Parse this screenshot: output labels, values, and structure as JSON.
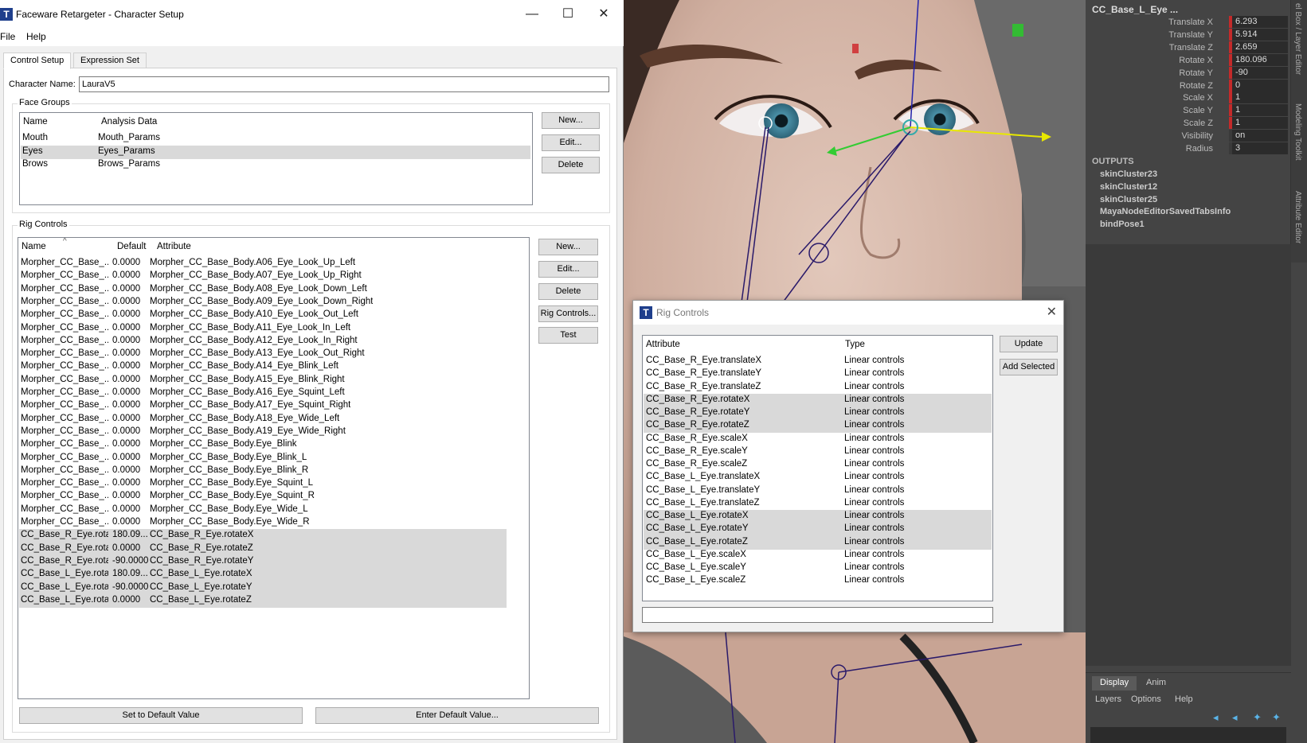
{
  "window": {
    "icon": "T",
    "title": "Faceware Retargeter - Character Setup",
    "controls": {
      "minimize": "—",
      "maximize": "☐",
      "close": "✕"
    }
  },
  "menu": [
    "File",
    "Help"
  ],
  "tabs": [
    "Control Setup",
    "Expression Set"
  ],
  "character": {
    "label": "Character Name:",
    "value": "LauraV5"
  },
  "face_groups": {
    "title": "Face Groups",
    "headers": [
      "Name",
      "Analysis Data"
    ],
    "rows": [
      {
        "name": "Mouth",
        "data": "Mouth_Params",
        "selected": false
      },
      {
        "name": "Eyes",
        "data": "Eyes_Params",
        "selected": true
      },
      {
        "name": "Brows",
        "data": "Brows_Params",
        "selected": false
      }
    ],
    "buttons": [
      "New...",
      "Edit...",
      "Delete"
    ]
  },
  "rig_controls": {
    "title": "Rig Controls",
    "headers": [
      "Name",
      "Default",
      "Attribute"
    ],
    "sort_indicator": "^",
    "rows": [
      {
        "name": "Morpher_CC_Base_...",
        "default": "0.0000",
        "attr": "Morpher_CC_Base_Body.A06_Eye_Look_Up_Left",
        "selected": false
      },
      {
        "name": "Morpher_CC_Base_...",
        "default": "0.0000",
        "attr": "Morpher_CC_Base_Body.A07_Eye_Look_Up_Right",
        "selected": false
      },
      {
        "name": "Morpher_CC_Base_...",
        "default": "0.0000",
        "attr": "Morpher_CC_Base_Body.A08_Eye_Look_Down_Left",
        "selected": false
      },
      {
        "name": "Morpher_CC_Base_...",
        "default": "0.0000",
        "attr": "Morpher_CC_Base_Body.A09_Eye_Look_Down_Right",
        "selected": false
      },
      {
        "name": "Morpher_CC_Base_...",
        "default": "0.0000",
        "attr": "Morpher_CC_Base_Body.A10_Eye_Look_Out_Left",
        "selected": false
      },
      {
        "name": "Morpher_CC_Base_...",
        "default": "0.0000",
        "attr": "Morpher_CC_Base_Body.A11_Eye_Look_In_Left",
        "selected": false
      },
      {
        "name": "Morpher_CC_Base_...",
        "default": "0.0000",
        "attr": "Morpher_CC_Base_Body.A12_Eye_Look_In_Right",
        "selected": false
      },
      {
        "name": "Morpher_CC_Base_...",
        "default": "0.0000",
        "attr": "Morpher_CC_Base_Body.A13_Eye_Look_Out_Right",
        "selected": false
      },
      {
        "name": "Morpher_CC_Base_...",
        "default": "0.0000",
        "attr": "Morpher_CC_Base_Body.A14_Eye_Blink_Left",
        "selected": false
      },
      {
        "name": "Morpher_CC_Base_...",
        "default": "0.0000",
        "attr": "Morpher_CC_Base_Body.A15_Eye_Blink_Right",
        "selected": false
      },
      {
        "name": "Morpher_CC_Base_...",
        "default": "0.0000",
        "attr": "Morpher_CC_Base_Body.A16_Eye_Squint_Left",
        "selected": false
      },
      {
        "name": "Morpher_CC_Base_...",
        "default": "0.0000",
        "attr": "Morpher_CC_Base_Body.A17_Eye_Squint_Right",
        "selected": false
      },
      {
        "name": "Morpher_CC_Base_...",
        "default": "0.0000",
        "attr": "Morpher_CC_Base_Body.A18_Eye_Wide_Left",
        "selected": false
      },
      {
        "name": "Morpher_CC_Base_...",
        "default": "0.0000",
        "attr": "Morpher_CC_Base_Body.A19_Eye_Wide_Right",
        "selected": false
      },
      {
        "name": "Morpher_CC_Base_...",
        "default": "0.0000",
        "attr": "Morpher_CC_Base_Body.Eye_Blink",
        "selected": false
      },
      {
        "name": "Morpher_CC_Base_...",
        "default": "0.0000",
        "attr": "Morpher_CC_Base_Body.Eye_Blink_L",
        "selected": false
      },
      {
        "name": "Morpher_CC_Base_...",
        "default": "0.0000",
        "attr": "Morpher_CC_Base_Body.Eye_Blink_R",
        "selected": false
      },
      {
        "name": "Morpher_CC_Base_...",
        "default": "0.0000",
        "attr": "Morpher_CC_Base_Body.Eye_Squint_L",
        "selected": false
      },
      {
        "name": "Morpher_CC_Base_...",
        "default": "0.0000",
        "attr": "Morpher_CC_Base_Body.Eye_Squint_R",
        "selected": false
      },
      {
        "name": "Morpher_CC_Base_...",
        "default": "0.0000",
        "attr": "Morpher_CC_Base_Body.Eye_Wide_L",
        "selected": false
      },
      {
        "name": "Morpher_CC_Base_...",
        "default": "0.0000",
        "attr": "Morpher_CC_Base_Body.Eye_Wide_R",
        "selected": false
      },
      {
        "name": "CC_Base_R_Eye.rota...",
        "default": "180.09...",
        "attr": "CC_Base_R_Eye.rotateX",
        "selected": true
      },
      {
        "name": "CC_Base_R_Eye.rota...",
        "default": "0.0000",
        "attr": "CC_Base_R_Eye.rotateZ",
        "selected": true
      },
      {
        "name": "CC_Base_R_Eye.rota...",
        "default": "-90.0000",
        "attr": "CC_Base_R_Eye.rotateY",
        "selected": true
      },
      {
        "name": "CC_Base_L_Eye.rota...",
        "default": "180.09...",
        "attr": "CC_Base_L_Eye.rotateX",
        "selected": true
      },
      {
        "name": "CC_Base_L_Eye.rota...",
        "default": "-90.0000",
        "attr": "CC_Base_L_Eye.rotateY",
        "selected": true
      },
      {
        "name": "CC_Base_L_Eye.rota...",
        "default": "0.0000",
        "attr": "CC_Base_L_Eye.rotateZ",
        "selected": true
      }
    ],
    "buttons": [
      "New...",
      "Edit...",
      "Delete",
      "Rig Controls...",
      "Test"
    ],
    "bottom_buttons": [
      "Set to Default Value",
      "Enter Default Value..."
    ]
  },
  "rig_dialog": {
    "icon": "T",
    "title": "Rig Controls",
    "close": "✕",
    "headers": [
      "Attribute",
      "Type"
    ],
    "rows": [
      {
        "attr": "CC_Base_R_Eye.translateX",
        "type": "Linear controls",
        "selected": false
      },
      {
        "attr": "CC_Base_R_Eye.translateY",
        "type": "Linear controls",
        "selected": false
      },
      {
        "attr": "CC_Base_R_Eye.translateZ",
        "type": "Linear controls",
        "selected": false
      },
      {
        "attr": "CC_Base_R_Eye.rotateX",
        "type": "Linear controls",
        "selected": true
      },
      {
        "attr": "CC_Base_R_Eye.rotateY",
        "type": "Linear controls",
        "selected": true
      },
      {
        "attr": "CC_Base_R_Eye.rotateZ",
        "type": "Linear controls",
        "selected": true
      },
      {
        "attr": "CC_Base_R_Eye.scaleX",
        "type": "Linear controls",
        "selected": false
      },
      {
        "attr": "CC_Base_R_Eye.scaleY",
        "type": "Linear controls",
        "selected": false
      },
      {
        "attr": "CC_Base_R_Eye.scaleZ",
        "type": "Linear controls",
        "selected": false
      },
      {
        "attr": "CC_Base_L_Eye.translateX",
        "type": "Linear controls",
        "selected": false
      },
      {
        "attr": "CC_Base_L_Eye.translateY",
        "type": "Linear controls",
        "selected": false
      },
      {
        "attr": "CC_Base_L_Eye.translateZ",
        "type": "Linear controls",
        "selected": false
      },
      {
        "attr": "CC_Base_L_Eye.rotateX",
        "type": "Linear controls",
        "selected": true
      },
      {
        "attr": "CC_Base_L_Eye.rotateY",
        "type": "Linear controls",
        "selected": true
      },
      {
        "attr": "CC_Base_L_Eye.rotateZ",
        "type": "Linear controls",
        "selected": true
      },
      {
        "attr": "CC_Base_L_Eye.scaleX",
        "type": "Linear controls",
        "selected": false
      },
      {
        "attr": "CC_Base_L_Eye.scaleY",
        "type": "Linear controls",
        "selected": false
      },
      {
        "attr": "CC_Base_L_Eye.scaleZ",
        "type": "Linear controls",
        "selected": false
      }
    ],
    "buttons": [
      "Update",
      "Add Selected"
    ]
  },
  "maya": {
    "node_title": "CC_Base_L_Eye ...",
    "attributes": [
      {
        "label": "Translate X",
        "value": "6.293",
        "keyed": true
      },
      {
        "label": "Translate Y",
        "value": "5.914",
        "keyed": true
      },
      {
        "label": "Translate Z",
        "value": "2.659",
        "keyed": true
      },
      {
        "label": "Rotate X",
        "value": "180.096",
        "keyed": true
      },
      {
        "label": "Rotate Y",
        "value": "-90",
        "keyed": true
      },
      {
        "label": "Rotate Z",
        "value": "0",
        "keyed": true
      },
      {
        "label": "Scale X",
        "value": "1",
        "keyed": true
      },
      {
        "label": "Scale Y",
        "value": "1",
        "keyed": true
      },
      {
        "label": "Scale Z",
        "value": "1",
        "keyed": true
      },
      {
        "label": "Visibility",
        "value": "on",
        "keyed": false
      },
      {
        "label": "Radius",
        "value": "3",
        "keyed": false
      }
    ],
    "outputs_title": "OUTPUTS",
    "outputs": [
      "skinCluster23",
      "skinCluster12",
      "skinCluster25",
      "MayaNodeEditorSavedTabsInfo",
      "bindPose1"
    ],
    "side_tabs": [
      "el Box / Layer Editor",
      "Modeling Toolkit",
      "Attribute Editor"
    ],
    "layer_tabs": [
      "Display",
      "Anim"
    ],
    "layer_menu": [
      "Layers",
      "Options",
      "Help"
    ],
    "layer_icons": [
      "new-layer-icon",
      "new-layer-from-selection-icon",
      "move-up-icon",
      "move-down-icon"
    ],
    "colors": {
      "keyed": "#c42a2a",
      "panel": "#444444",
      "selection": "#d9d9d9",
      "accent": "#1f3f8c"
    }
  }
}
